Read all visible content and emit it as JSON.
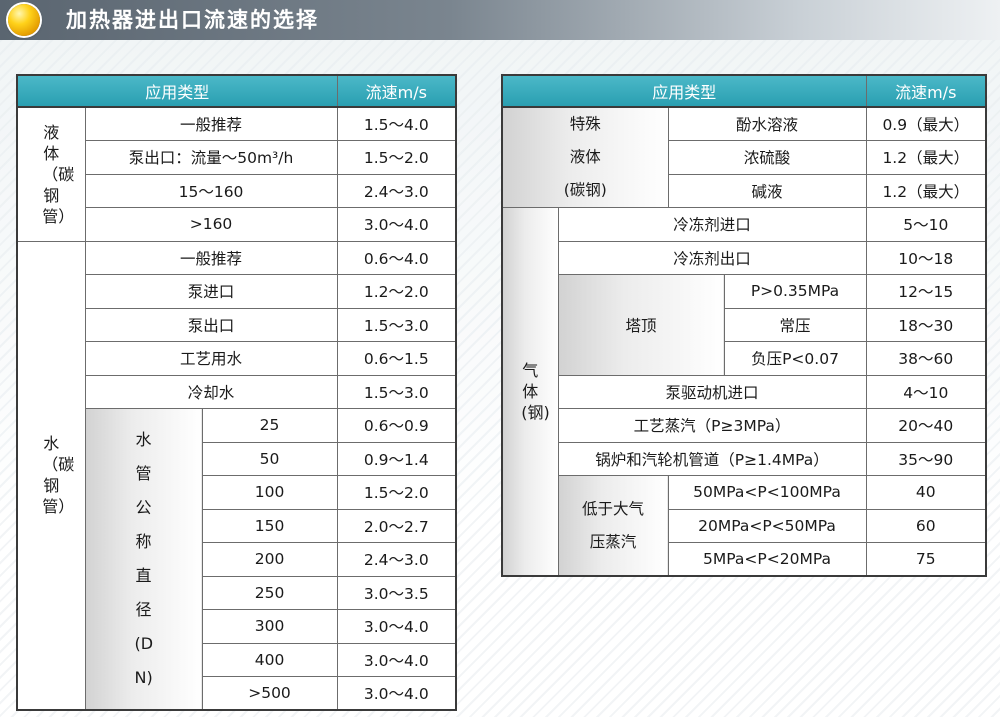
{
  "title": "加热器进出口流速的选择",
  "colors": {
    "header_teal": "#2a9fb1",
    "title_bar_dark": "#5a6570",
    "ball_gold": "#ffd21a"
  },
  "left_table": {
    "header": {
      "type": "应用类型",
      "speed": "流速m/s"
    },
    "group1": {
      "label": "液体（碳钢管）",
      "rows": [
        {
          "item": "一般推荐",
          "speed": "1.5～4.0"
        },
        {
          "item": "泵出口：流量～50m³/h",
          "speed": "1.5～2.0"
        },
        {
          "item": "15～160",
          "speed": "2.4～3.0"
        },
        {
          "item": ">160",
          "speed": "3.0～4.0"
        }
      ]
    },
    "group2": {
      "label": "水（碳钢管）",
      "rows": [
        {
          "item": "一般推荐",
          "speed": "0.6～4.0"
        },
        {
          "item": "泵进口",
          "speed": "1.2～2.0"
        },
        {
          "item": "泵出口",
          "speed": "1.5～3.0"
        },
        {
          "item": "工艺用水",
          "speed": "0.6～1.5"
        },
        {
          "item": "冷却水",
          "speed": "1.5～3.0"
        }
      ],
      "sub": {
        "label": "水管公称直径(DN)",
        "rows": [
          {
            "dn": "25",
            "speed": "0.6～0.9"
          },
          {
            "dn": "50",
            "speed": "0.9～1.4"
          },
          {
            "dn": "100",
            "speed": "1.5～2.0"
          },
          {
            "dn": "150",
            "speed": "2.0～2.7"
          },
          {
            "dn": "200",
            "speed": "2.4～3.0"
          },
          {
            "dn": "250",
            "speed": "3.0～3.5"
          },
          {
            "dn": "300",
            "speed": "3.0～4.0"
          },
          {
            "dn": "400",
            "speed": "3.0～4.0"
          },
          {
            "dn": ">500",
            "speed": "3.0～4.0"
          }
        ]
      }
    }
  },
  "right_table": {
    "header": {
      "type": "应用类型",
      "speed": "流速m/s"
    },
    "special": {
      "label_line1": "特殊",
      "label_line2": "液体",
      "label_line3": "(碳钢)",
      "rows": [
        {
          "item": "酚水溶液",
          "speed": "0.9（最大）"
        },
        {
          "item": "浓硫酸",
          "speed": "1.2（最大）"
        },
        {
          "item": "碱液",
          "speed": "1.2（最大）"
        }
      ]
    },
    "gas": {
      "label": "气体(钢)",
      "rows_a": [
        {
          "item": "冷冻剂进口",
          "speed": "5～10"
        },
        {
          "item": "冷冻剂出口",
          "speed": "10～18"
        }
      ],
      "tower": {
        "label": "塔顶",
        "rows": [
          {
            "item": "P>0.35MPa",
            "speed": "12～15"
          },
          {
            "item": "常压",
            "speed": "18～30"
          },
          {
            "item": "负压P<0.07",
            "speed": "38～60"
          }
        ]
      },
      "rows_b": [
        {
          "item": "泵驱动机进口",
          "speed": "4～10"
        },
        {
          "item": "工艺蒸汽（P≥3MPa）",
          "speed": "20～40"
        },
        {
          "item": "锅炉和汽轮机管道（P≥1.4MPa）",
          "speed": "35～90"
        }
      ],
      "low_pressure": {
        "label_line1": "低于大气",
        "label_line2": "压蒸汽",
        "rows": [
          {
            "item": "50MPa<P<100MPa",
            "speed": "40"
          },
          {
            "item": "20MPa<P<50MPa",
            "speed": "60"
          },
          {
            "item": "5MPa<P<20MPa",
            "speed": "75"
          }
        ]
      }
    }
  }
}
